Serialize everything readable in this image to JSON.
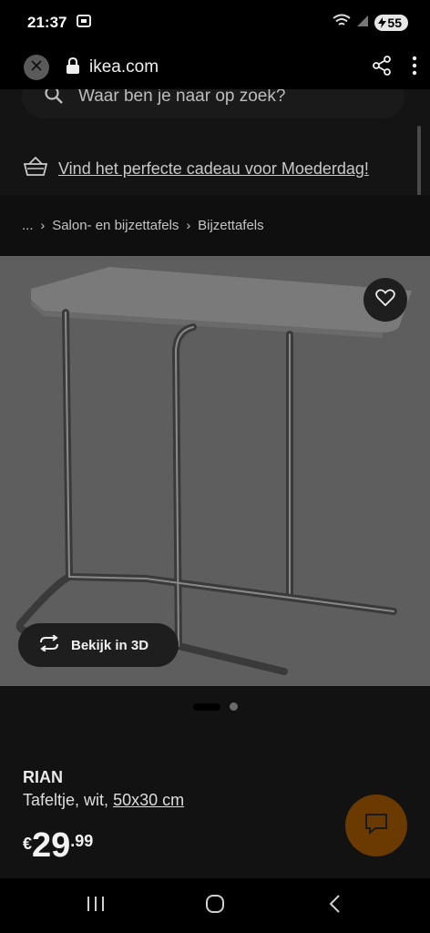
{
  "status_bar": {
    "time": "21:37",
    "battery": "55"
  },
  "browser": {
    "url": "ikea.com",
    "icons": [
      "close-icon",
      "lock-icon",
      "share-icon",
      "more-vert-icon"
    ]
  },
  "search": {
    "placeholder": "Waar ben je naar op zoek?"
  },
  "promo": {
    "text": "Vind het perfecte cadeau voor Moederdag!"
  },
  "breadcrumb": {
    "ellipsis": "...",
    "items": [
      "Salon- en bijzettafels",
      "Bijzettafels"
    ]
  },
  "gallery": {
    "view_3d_label": "Bekijk in 3D",
    "image_count": 2,
    "active_index": 0
  },
  "product": {
    "name": "RIAN",
    "description": "Tafeltje, wit,",
    "size": "50x30 cm",
    "price": {
      "currency": "€",
      "integer": "29",
      "decimal": ".99"
    }
  },
  "colors": {
    "accent_fab": "#6b3a00",
    "overlay": "#000000"
  }
}
